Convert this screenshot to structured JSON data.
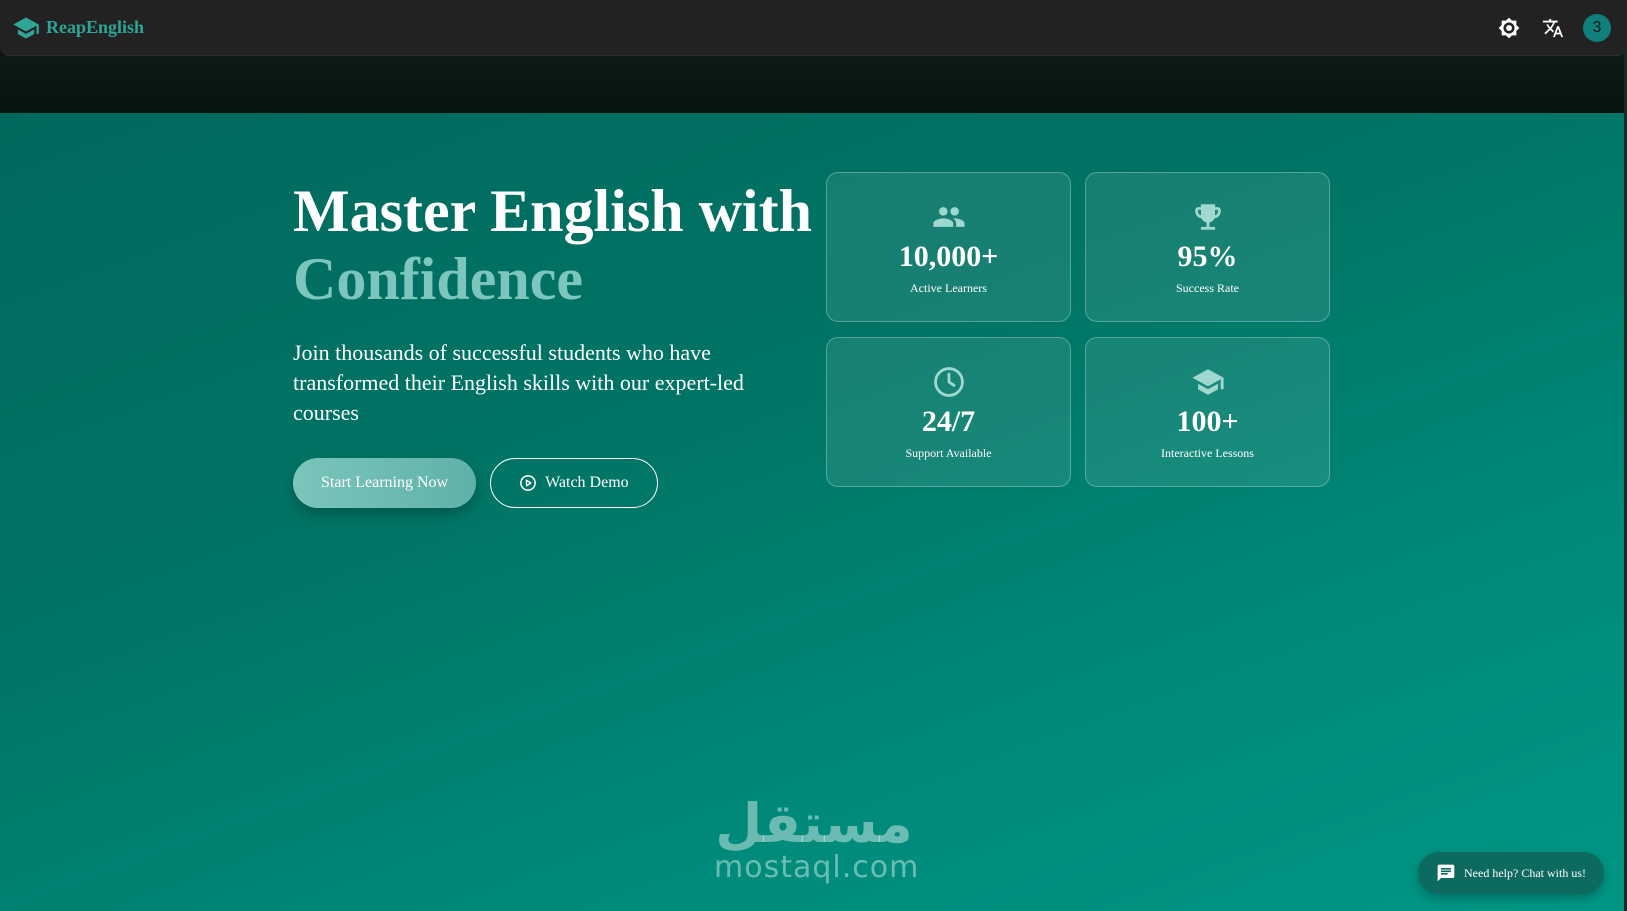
{
  "nav": {
    "brand_name": "ReapEnglish",
    "brand_icon": "graduation-cap-icon",
    "theme_icon": "brightness-icon",
    "language_icon": "translate-icon",
    "avatar_initial": "3"
  },
  "hero": {
    "title_line1": "Master English with",
    "title_accent": "Confidence",
    "subtitle": "Join thousands of successful students who have transformed their English skills with our expert-led courses",
    "primary_button": "Start Learning Now",
    "secondary_button": "Watch Demo"
  },
  "stats": [
    {
      "icon": "people-icon",
      "value": "10,000+",
      "label": "Active Learners"
    },
    {
      "icon": "trophy-icon",
      "value": "95%",
      "label": "Success Rate"
    },
    {
      "icon": "clock-icon",
      "value": "24/7",
      "label": "Support Available"
    },
    {
      "icon": "graduation-cap-icon",
      "value": "100+",
      "label": "Interactive Lessons"
    }
  ],
  "watermark": {
    "arabic": "مستقل",
    "latin": "mostaql.com"
  },
  "chat": {
    "label": "Need help? Chat with us!"
  },
  "colors": {
    "brand": "#2ea596",
    "accent_text": "#7cc6bd",
    "hero_start": "#00695d",
    "hero_end": "#009684",
    "navbar": "#222222"
  }
}
